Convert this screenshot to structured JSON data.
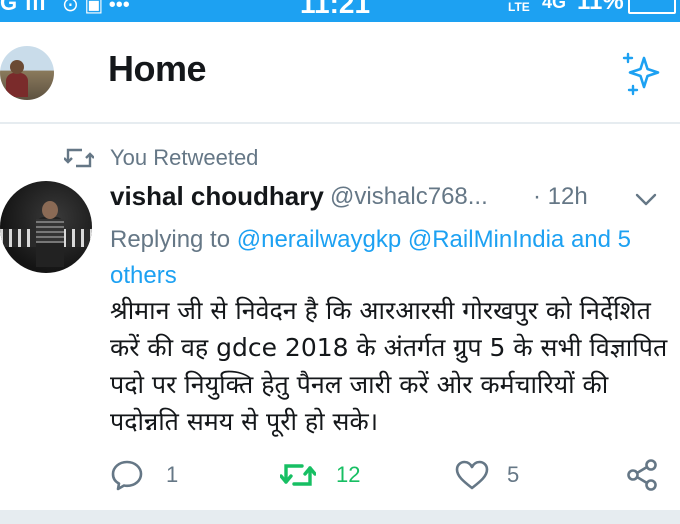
{
  "status_bar": {
    "left_text": "G ıll",
    "notif_icons": "⊙ ▣ •••",
    "time": "11:21",
    "lte": "LTE",
    "signal": "4G",
    "battery": "11%"
  },
  "header": {
    "title": "Home"
  },
  "tweet": {
    "retweet_context": "You Retweeted",
    "author_name": "vishal choudhary",
    "author_handle": "@vishalc768...",
    "time": "· 12h",
    "replying_prefix": "Replying to",
    "mention_1": "@nerailwaygkp",
    "mention_2": "@RailMinIndia",
    "mention_3": "and 5 others",
    "text": "श्रीमान जी से निवेदन है कि आरआरसी गोरखपुर को निर्देशित करें की  वह gdce 2018 के अंतर्गत  ग्रुप 5 के सभी विज्ञापित पदो पर नियुक्ति हेतु पैनल जारी करें ओर कर्मचारियों की पदोन्नति समय से पूरी हो सके।",
    "reply_count": "1",
    "retweet_count": "12",
    "like_count": "5"
  },
  "colors": {
    "accent": "#1da1f2",
    "muted": "#657786",
    "retweeted": "#17bf63",
    "text": "#14171a"
  }
}
